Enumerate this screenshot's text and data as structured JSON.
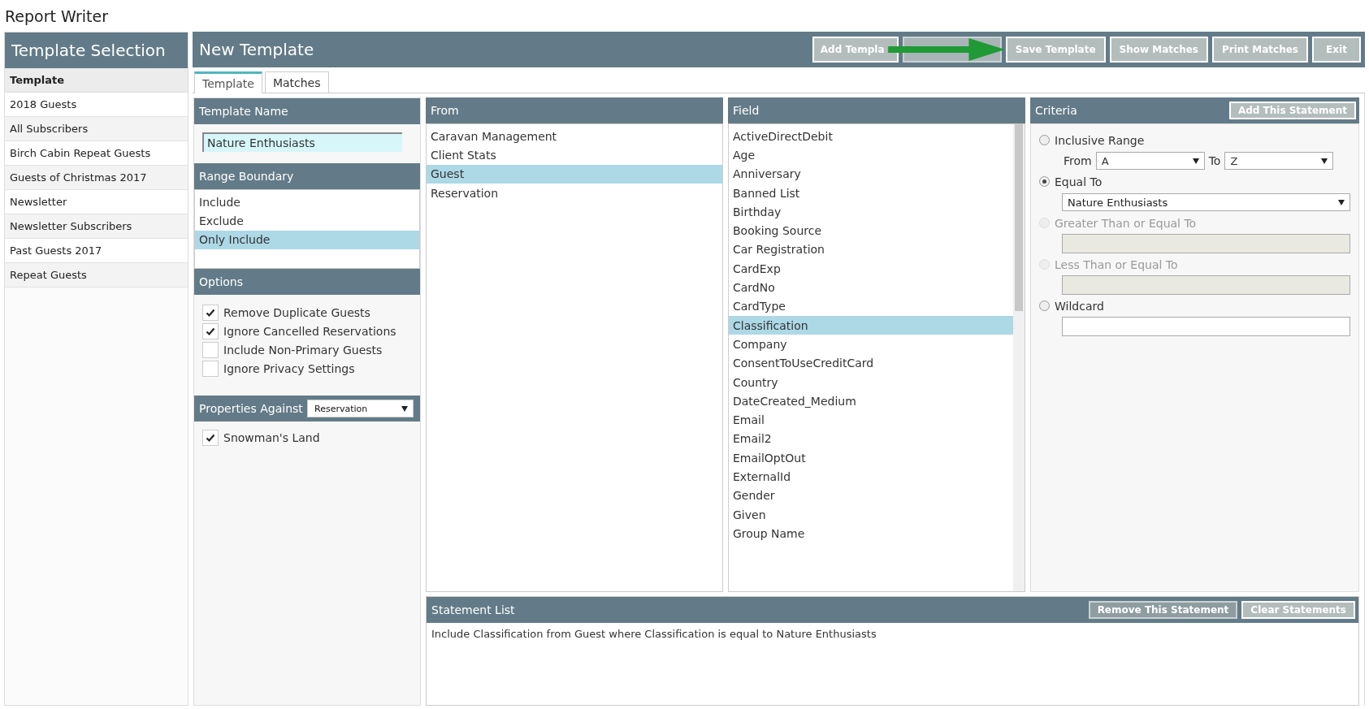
{
  "page_title": "Report Writer",
  "sidebar": {
    "title": "Template Selection",
    "items": [
      {
        "label": "Template",
        "kind": "heading"
      },
      {
        "label": "2018 Guests",
        "kind": "item"
      },
      {
        "label": "All Subscribers",
        "kind": "item"
      },
      {
        "label": "Birch Cabin Repeat Guests",
        "kind": "item"
      },
      {
        "label": "Guests of Christmas 2017",
        "kind": "item"
      },
      {
        "label": "Newsletter",
        "kind": "item"
      },
      {
        "label": "Newsletter Subscribers",
        "kind": "item"
      },
      {
        "label": "Past Guests 2017",
        "kind": "item"
      },
      {
        "label": "Repeat Guests",
        "kind": "item"
      }
    ]
  },
  "header": {
    "title": "New Template",
    "buttons": [
      {
        "label": "Add Templa",
        "disabled": false
      },
      {
        "disabled": true
      },
      {
        "label": "Save Template",
        "disabled": false
      },
      {
        "label": "Show Matches",
        "disabled": false
      },
      {
        "label": "Print Matches",
        "disabled": false
      },
      {
        "label": "Exit",
        "disabled": false
      }
    ]
  },
  "annotation": {
    "kind": "arrow"
  },
  "tabs": [
    {
      "label": "Template",
      "selected": true
    },
    {
      "label": "Matches",
      "selected": false
    }
  ],
  "template_name": {
    "title": "Template Name",
    "value": "Nature Enthusiasts"
  },
  "range_boundary": {
    "title": "Range Boundary",
    "items": [
      {
        "label": "Include",
        "selected": false
      },
      {
        "label": "Exclude",
        "selected": false
      },
      {
        "label": "Only Include",
        "selected": true
      }
    ]
  },
  "options": {
    "title": "Options",
    "items": [
      {
        "label": "Remove Duplicate Guests",
        "checked": true
      },
      {
        "label": "Ignore Cancelled Reservations",
        "checked": true
      },
      {
        "label": "Include Non-Primary Guests",
        "checked": false
      },
      {
        "label": "Ignore Privacy Settings",
        "checked": false
      }
    ]
  },
  "properties": {
    "title": "Properties Against",
    "select": "Reservation",
    "items": [
      {
        "label": "Snowman's Land",
        "checked": true
      }
    ]
  },
  "from": {
    "title": "From",
    "items": [
      {
        "label": "Caravan Management",
        "selected": false
      },
      {
        "label": "Client Stats",
        "selected": false
      },
      {
        "label": "Guest",
        "selected": true
      },
      {
        "label": "Reservation",
        "selected": false
      }
    ]
  },
  "field": {
    "title": "Field",
    "items": [
      {
        "label": "ActiveDirectDebit",
        "selected": false
      },
      {
        "label": "Age",
        "selected": false
      },
      {
        "label": "Anniversary",
        "selected": false
      },
      {
        "label": "Banned List",
        "selected": false
      },
      {
        "label": "Birthday",
        "selected": false
      },
      {
        "label": "Booking Source",
        "selected": false
      },
      {
        "label": "Car Registration",
        "selected": false
      },
      {
        "label": "CardExp",
        "selected": false
      },
      {
        "label": "CardNo",
        "selected": false
      },
      {
        "label": "CardType",
        "selected": false
      },
      {
        "label": "Classification",
        "selected": true
      },
      {
        "label": "Company",
        "selected": false
      },
      {
        "label": "ConsentToUseCreditCard",
        "selected": false
      },
      {
        "label": "Country",
        "selected": false
      },
      {
        "label": "DateCreated_Medium",
        "selected": false
      },
      {
        "label": "Email",
        "selected": false
      },
      {
        "label": "Email2",
        "selected": false
      },
      {
        "label": "EmailOptOut",
        "selected": false
      },
      {
        "label": "ExternalId",
        "selected": false
      },
      {
        "label": "Gender",
        "selected": false
      },
      {
        "label": "Given",
        "selected": false
      },
      {
        "label": "Group Name",
        "selected": false
      }
    ]
  },
  "criteria": {
    "title": "Criteria",
    "button": "Add This Statement",
    "options": [
      {
        "kind": "range",
        "label": "Inclusive Range",
        "selected": false,
        "disabled": false,
        "from_label": "From",
        "from": "A",
        "to_label": "To",
        "to": "Z"
      },
      {
        "kind": "select",
        "label": "Equal To",
        "selected": true,
        "disabled": false,
        "value": "Nature Enthusiasts"
      },
      {
        "kind": "text",
        "label": "Greater Than or Equal To",
        "selected": false,
        "disabled": true
      },
      {
        "kind": "text",
        "label": "Less Than or Equal To",
        "selected": false,
        "disabled": true
      },
      {
        "kind": "text",
        "label": "Wildcard",
        "selected": false,
        "disabled": false
      }
    ]
  },
  "statement_list": {
    "title": "Statement List",
    "buttons": [
      {
        "label": "Remove This Statement",
        "disabled": true
      },
      {
        "label": "Clear Statements",
        "disabled": false
      }
    ],
    "statements": [
      "Include Classification from Guest where Classification is equal to Nature Enthusiasts"
    ]
  }
}
